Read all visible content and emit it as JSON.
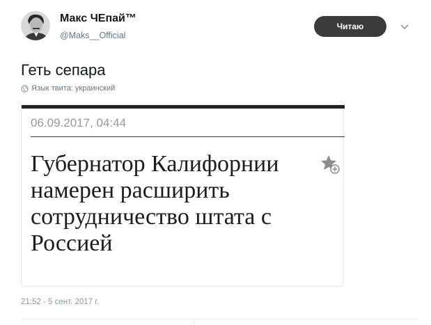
{
  "user": {
    "name": "Макс ЧЕпай™",
    "handle": "@Maks__Official"
  },
  "follow_button": {
    "label": "Читаю"
  },
  "tweet": {
    "text": "Геть сепара",
    "language_note": "Язык твита: украинский",
    "timestamp": "21:52 - 5 сент. 2017 г."
  },
  "card": {
    "date": "06.09.2017, 04:44",
    "title": "Губернатор Калифорнии намерен расширить сотрудничество штата с Россией"
  },
  "icons": {
    "caret": "chevron-down-icon",
    "globe": "globe-icon",
    "favorite": "star-plus-icon"
  },
  "colors": {
    "follow_button_bg": "#3b3b3b",
    "secondary_text": "#657786",
    "card_topbar": "#222222"
  }
}
